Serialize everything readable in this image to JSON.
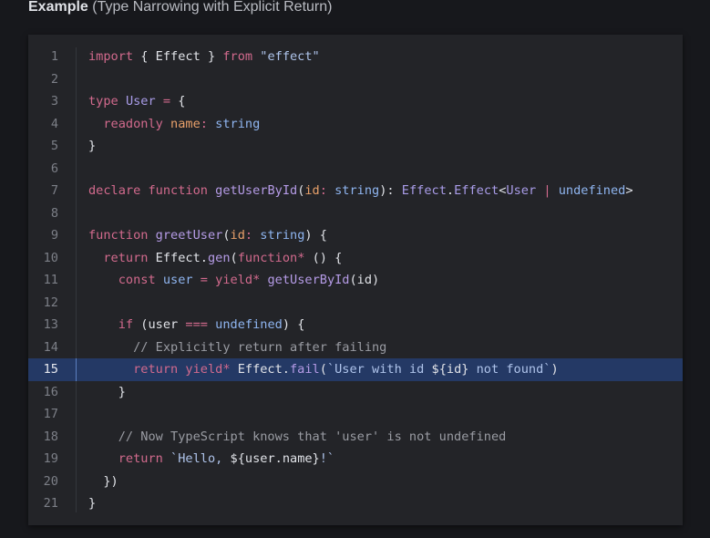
{
  "heading": {
    "bold": "Example",
    "subtitle": "(Type Narrowing with Explicit Return)"
  },
  "editor": {
    "highlighted_line": 15,
    "lines": [
      {
        "n": "1",
        "tokens": [
          [
            "kw",
            "import"
          ],
          [
            "pl",
            " { Effect } "
          ],
          [
            "kw",
            "from"
          ],
          [
            "pl",
            " "
          ],
          [
            "st",
            "\"effect\""
          ]
        ]
      },
      {
        "n": "2",
        "tokens": []
      },
      {
        "n": "3",
        "tokens": [
          [
            "kw",
            "type"
          ],
          [
            "pl",
            " "
          ],
          [
            "tp",
            "User"
          ],
          [
            "pl",
            " "
          ],
          [
            "op",
            "="
          ],
          [
            "pl",
            " {"
          ]
        ]
      },
      {
        "n": "4",
        "tokens": [
          [
            "pl",
            "  "
          ],
          [
            "kw",
            "readonly"
          ],
          [
            "pl",
            " "
          ],
          [
            "pm",
            "name"
          ],
          [
            "op",
            ":"
          ],
          [
            "pl",
            " "
          ],
          [
            "ty",
            "string"
          ]
        ]
      },
      {
        "n": "5",
        "tokens": [
          [
            "pl",
            "}"
          ]
        ]
      },
      {
        "n": "6",
        "tokens": []
      },
      {
        "n": "7",
        "tokens": [
          [
            "kw",
            "declare"
          ],
          [
            "pl",
            " "
          ],
          [
            "kw",
            "function"
          ],
          [
            "pl",
            " "
          ],
          [
            "fn",
            "getUserById"
          ],
          [
            "pl",
            "("
          ],
          [
            "pm",
            "id"
          ],
          [
            "op",
            ":"
          ],
          [
            "pl",
            " "
          ],
          [
            "ty",
            "string"
          ],
          [
            "pl",
            "): "
          ],
          [
            "tp",
            "Effect"
          ],
          [
            "pl",
            "."
          ],
          [
            "tp",
            "Effect"
          ],
          [
            "pl",
            "<"
          ],
          [
            "tp",
            "User"
          ],
          [
            "pl",
            " "
          ],
          [
            "op",
            "|"
          ],
          [
            "pl",
            " "
          ],
          [
            "ty",
            "undefined"
          ],
          [
            "pl",
            ">"
          ]
        ]
      },
      {
        "n": "8",
        "tokens": []
      },
      {
        "n": "9",
        "tokens": [
          [
            "kw",
            "function"
          ],
          [
            "pl",
            " "
          ],
          [
            "fn",
            "greetUser"
          ],
          [
            "pl",
            "("
          ],
          [
            "pm",
            "id"
          ],
          [
            "op",
            ":"
          ],
          [
            "pl",
            " "
          ],
          [
            "ty",
            "string"
          ],
          [
            "pl",
            ") {"
          ]
        ]
      },
      {
        "n": "10",
        "tokens": [
          [
            "pl",
            "  "
          ],
          [
            "kw",
            "return"
          ],
          [
            "pl",
            " Effect."
          ],
          [
            "fn",
            "gen"
          ],
          [
            "pl",
            "("
          ],
          [
            "kw",
            "function*"
          ],
          [
            "pl",
            " () {"
          ]
        ]
      },
      {
        "n": "11",
        "tokens": [
          [
            "pl",
            "    "
          ],
          [
            "kw",
            "const"
          ],
          [
            "pl",
            " "
          ],
          [
            "ty",
            "user"
          ],
          [
            "pl",
            " "
          ],
          [
            "op",
            "="
          ],
          [
            "pl",
            " "
          ],
          [
            "kw",
            "yield*"
          ],
          [
            "pl",
            " "
          ],
          [
            "fn",
            "getUserById"
          ],
          [
            "pl",
            "(id)"
          ]
        ]
      },
      {
        "n": "12",
        "tokens": []
      },
      {
        "n": "13",
        "tokens": [
          [
            "pl",
            "    "
          ],
          [
            "kw",
            "if"
          ],
          [
            "pl",
            " (user "
          ],
          [
            "op",
            "==="
          ],
          [
            "pl",
            " "
          ],
          [
            "ty",
            "undefined"
          ],
          [
            "pl",
            ") {"
          ]
        ]
      },
      {
        "n": "14",
        "tokens": [
          [
            "pl",
            "      "
          ],
          [
            "cm",
            "// Explicitly return after failing"
          ]
        ]
      },
      {
        "n": "15",
        "tokens": [
          [
            "pl",
            "      "
          ],
          [
            "kw",
            "return"
          ],
          [
            "pl",
            " "
          ],
          [
            "kw",
            "yield*"
          ],
          [
            "pl",
            " Effect."
          ],
          [
            "fn",
            "fail"
          ],
          [
            "pl",
            "("
          ],
          [
            "st",
            "`User with id "
          ],
          [
            "pl",
            "${id}"
          ],
          [
            "st",
            " not found`"
          ],
          [
            "pl",
            ")"
          ]
        ]
      },
      {
        "n": "16",
        "tokens": [
          [
            "pl",
            "    }"
          ]
        ]
      },
      {
        "n": "17",
        "tokens": []
      },
      {
        "n": "18",
        "tokens": [
          [
            "pl",
            "    "
          ],
          [
            "cm",
            "// Now TypeScript knows that 'user' is not undefined"
          ]
        ]
      },
      {
        "n": "19",
        "tokens": [
          [
            "pl",
            "    "
          ],
          [
            "kw",
            "return"
          ],
          [
            "pl",
            " "
          ],
          [
            "st",
            "`Hello, "
          ],
          [
            "pl",
            "${user.name}"
          ],
          [
            "st",
            "!`"
          ]
        ]
      },
      {
        "n": "20",
        "tokens": [
          [
            "pl",
            "  })"
          ]
        ]
      },
      {
        "n": "21",
        "tokens": [
          [
            "pl",
            "}"
          ]
        ]
      }
    ]
  }
}
